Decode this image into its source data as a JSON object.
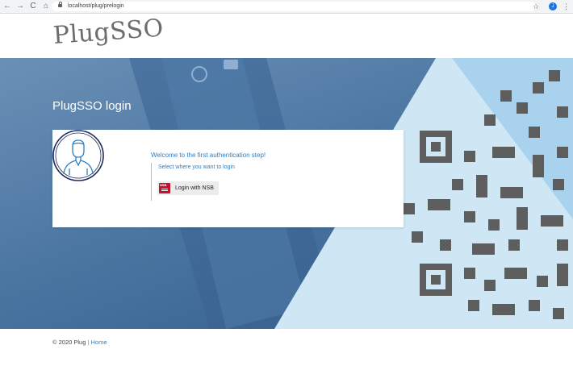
{
  "browser": {
    "url": "localhost/plug/prelogin",
    "back_icon": "←",
    "forward_icon": "→",
    "reload_icon": "C",
    "home_icon": "⌂",
    "star_icon": "☆",
    "profile_initial": "J",
    "menu_icon": "⋮"
  },
  "header": {
    "logo_text": "PlugSSO"
  },
  "hero": {
    "title": "PlugSSO login"
  },
  "card": {
    "welcome": "Welcome to the first authentication step!",
    "instruction": "Select where you want to login",
    "nsb_logo_text": "NSB",
    "nsb_button_label": "Login with NSB"
  },
  "footer": {
    "copyright": "© 2020 Plug",
    "separator": " | ",
    "home_link": "Home"
  },
  "colors": {
    "accent": "#2f7fc1",
    "nsb_red": "#c8102e"
  }
}
